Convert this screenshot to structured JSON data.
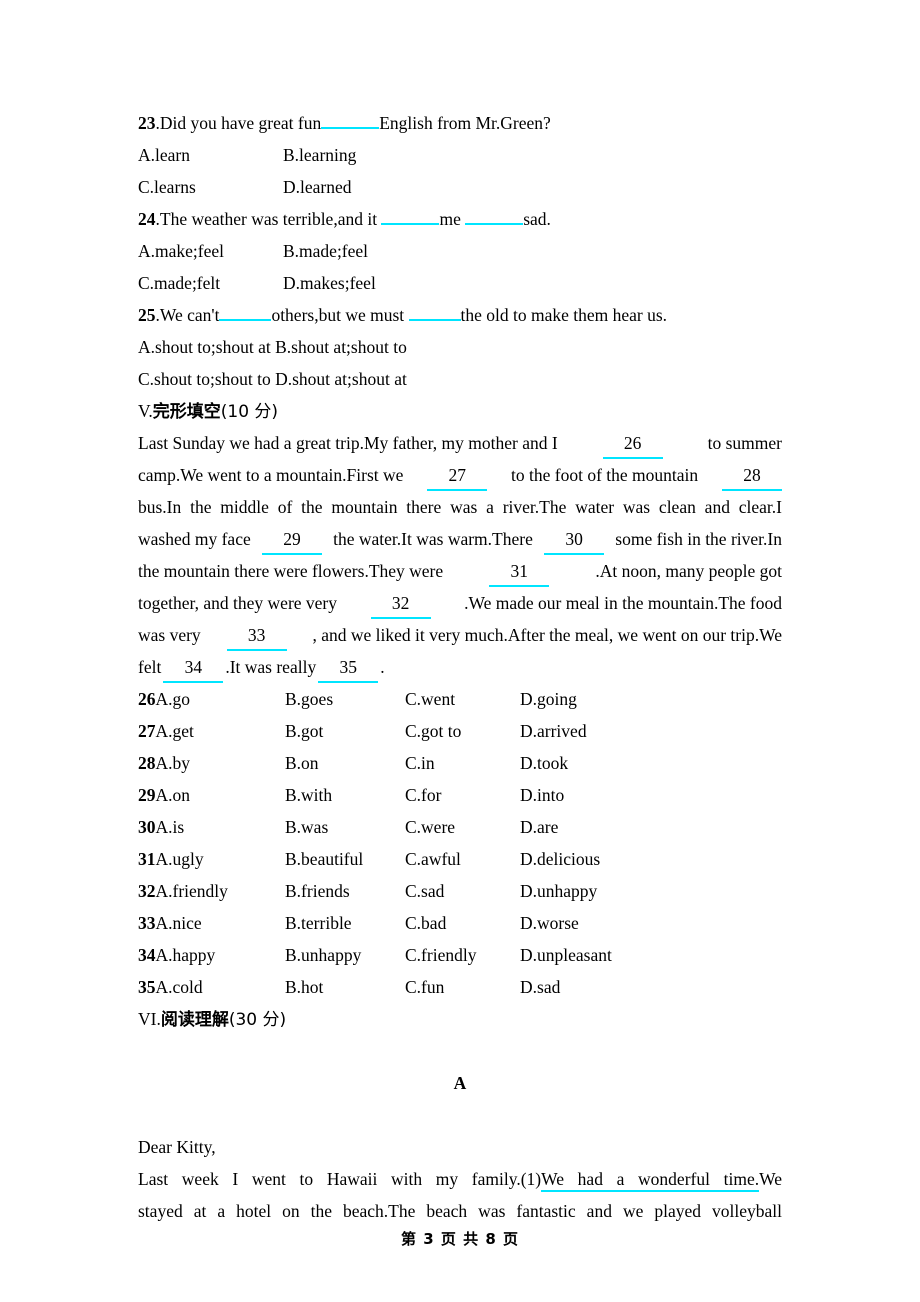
{
  "document": {
    "page_footer": "第 3 页 共 8 页",
    "accent_color": "#00e5ff"
  },
  "grammar_questions": [
    {
      "number": "23",
      "stem_before": ".Did you have great fun",
      "stem_after": "English from Mr.Green?",
      "options": [
        "A.learn",
        "B.learning",
        "C.learns",
        "D.learned"
      ],
      "layout": "two-column"
    },
    {
      "number": "24",
      "stem_before": ".The weather was terrible,and it",
      "stem_mid": "me",
      "stem_after": "sad.",
      "options": [
        "A.make;feel",
        "B.made;feel",
        "C.made;felt",
        "D.makes;feel"
      ],
      "layout": "two-column"
    },
    {
      "number": "25",
      "stem_before": ".We can't",
      "stem_mid": "others,but we must",
      "stem_after": "the old to make them hear us.",
      "options_wide": [
        "A.shout to;shout at B.shout at;shout to",
        "C.shout to;shout to D.shout at;shout at"
      ],
      "layout": "wide"
    }
  ],
  "section_cloze": {
    "numeral": "V.",
    "title_cn": "完形填空",
    "points": "(10 分)",
    "passage_lines": [
      {
        "segments": [
          "Last Sunday we had a great trip.My father, my mother and I",
          "26",
          "to summer"
        ],
        "indent": true,
        "justify": true
      },
      {
        "segments": [
          "camp.We went to a mountain.First we",
          "27",
          "to the foot of the mountain",
          "28"
        ],
        "indent": false,
        "justify": true
      },
      {
        "segments": [
          "bus.In the middle of the mountain there was a river.The water was clean and clear.I"
        ],
        "indent": false,
        "justify": true
      },
      {
        "segments": [
          "washed my face",
          "29",
          "the water.It was warm.There",
          "30",
          "some fish in the river.In"
        ],
        "indent": false,
        "justify": true
      },
      {
        "segments": [
          "the mountain there were flowers.They were",
          "31",
          ".At noon, many people got"
        ],
        "indent": false,
        "justify": true
      },
      {
        "segments": [
          "together, and they were very",
          "32",
          ".We made our meal in the mountain.The food"
        ],
        "indent": false,
        "justify": true
      },
      {
        "segments": [
          "was very",
          "33",
          ", and we liked it very much.After the meal, we went on our trip.We"
        ],
        "indent": false,
        "justify": true
      },
      {
        "segments": [
          "felt",
          "34",
          ".It was really",
          "35",
          "."
        ],
        "indent": false,
        "justify": false
      }
    ],
    "option_rows": [
      {
        "number": "26",
        "options": [
          "A.go",
          "B.goes",
          "C.went",
          "D.going"
        ]
      },
      {
        "number": "27",
        "options": [
          "A.get",
          "B.got",
          "C.got to",
          "D.arrived"
        ]
      },
      {
        "number": "28",
        "options": [
          "A.by",
          "B.on",
          "C.in",
          "D.took"
        ]
      },
      {
        "number": "29",
        "options": [
          "A.on",
          "B.with",
          "C.for",
          "D.into"
        ]
      },
      {
        "number": "30",
        "options": [
          "A.is",
          "B.was",
          "C.were",
          "D.are"
        ]
      },
      {
        "number": "31",
        "options": [
          "A.ugly",
          "B.beautiful",
          "C.awful",
          "D.delicious"
        ]
      },
      {
        "number": "32",
        "options": [
          "A.friendly",
          "B.friends",
          "C.sad",
          "D.unhappy"
        ]
      },
      {
        "number": "33",
        "options": [
          "A.nice",
          "B.terrible",
          "C.bad",
          "D.worse"
        ]
      },
      {
        "number": "34",
        "options": [
          "A.happy",
          "B.unhappy",
          "C.friendly",
          "D.unpleasant"
        ]
      },
      {
        "number": "35",
        "options": [
          "A.cold",
          "B.hot",
          "C.fun",
          "D.sad"
        ]
      }
    ]
  },
  "section_reading": {
    "numeral": "VI.",
    "title_cn": "阅读理解",
    "points": "(30 分)",
    "passage_label": "A",
    "salutation": "Dear Kitty,",
    "body_lines": [
      {
        "pre": "Last week I went to Hawaii with my family.(1)",
        "underlined": "We had a wonderful time.",
        "post": "We",
        "indent": true
      },
      {
        "plain": "stayed at a hotel on the beach.The beach was fantastic and we played volleyball",
        "indent": false
      }
    ]
  }
}
